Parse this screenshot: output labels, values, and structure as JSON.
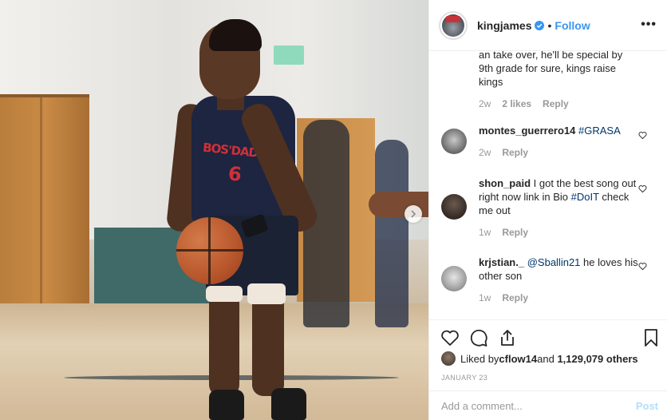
{
  "header": {
    "username": "kingjames",
    "separator": "•",
    "follow_label": "Follow",
    "more_label": "•••"
  },
  "photo": {
    "jersey_text": "BOS'DADE",
    "jersey_number": "6"
  },
  "comments": {
    "continued": {
      "text": "an take over, he'll be special by 9th grade for sure, kings raise kings",
      "time": "2w",
      "likes": "2 likes",
      "reply": "Reply"
    },
    "items": [
      {
        "user": "montes_guerrero14",
        "text_before": "",
        "mention": "",
        "text_after": "",
        "tag": "#GRASA",
        "trailing": "",
        "time": "2w",
        "reply": "Reply"
      },
      {
        "user": "shon_paid",
        "text_before": "I got the best song out right now link in Bio ",
        "tag": "#DoIT",
        "trailing": " check me out",
        "time": "1w",
        "reply": "Reply"
      },
      {
        "user": "krjstian._",
        "mention": "@Sballin21",
        "text_after": " he loves his other son",
        "time": "1w",
        "reply": "Reply"
      }
    ]
  },
  "likes": {
    "prefix": "Liked by ",
    "user": "cflow14",
    "middle": " and ",
    "count": "1,129,079 others"
  },
  "date": "JANUARY 23",
  "add_comment": {
    "placeholder": "Add a comment...",
    "post_label": "Post"
  },
  "colors": {
    "link_blue": "#3897f0",
    "tag_blue": "#003569",
    "meta_gray": "#999999",
    "post_disabled": "#b2dffc"
  }
}
